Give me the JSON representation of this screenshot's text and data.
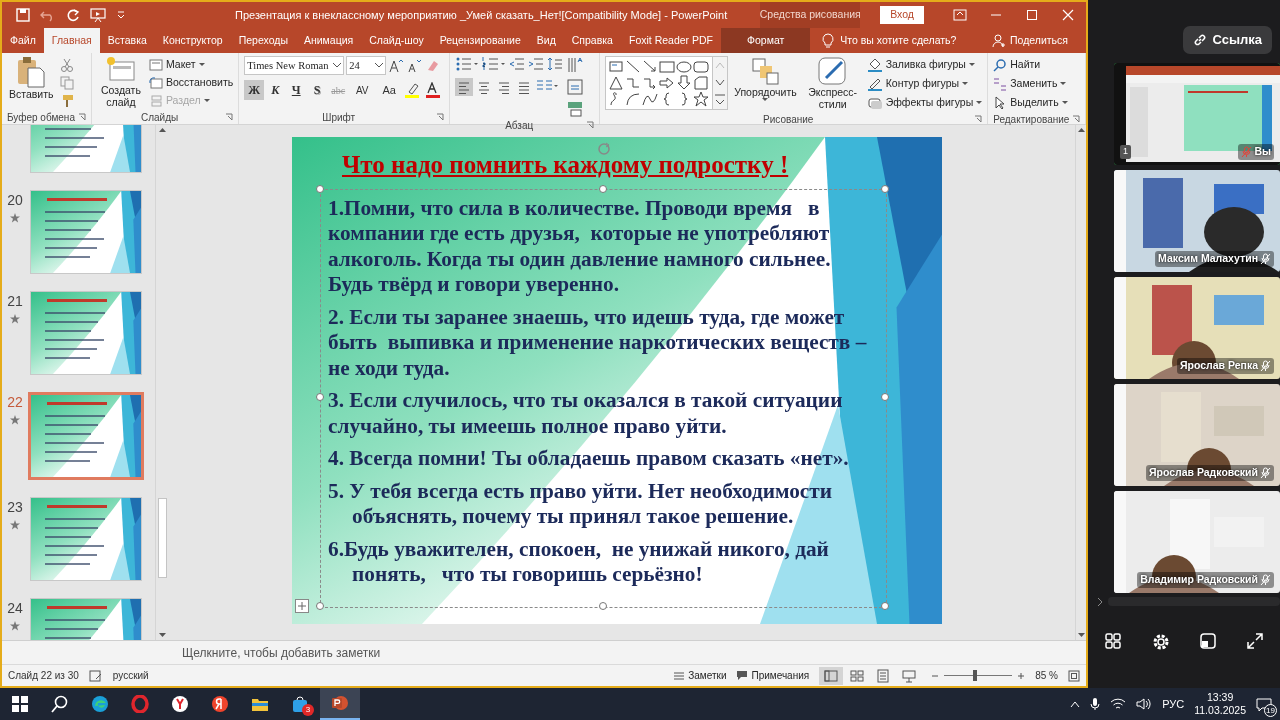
{
  "window": {
    "title": "Презентация к внеклассному мероприятию _Умей сказать_Нет![Compatibility Mode]  -  PowerPoint",
    "context_label": "Средства рисования",
    "sign_in": "Вход"
  },
  "tabs": [
    {
      "label": "Файл",
      "selected": false,
      "kind": "normal"
    },
    {
      "label": "Главная",
      "selected": true,
      "kind": "normal"
    },
    {
      "label": "Вставка",
      "selected": false,
      "kind": "normal"
    },
    {
      "label": "Конструктор",
      "selected": false,
      "kind": "normal"
    },
    {
      "label": "Переходы",
      "selected": false,
      "kind": "normal"
    },
    {
      "label": "Анимация",
      "selected": false,
      "kind": "normal"
    },
    {
      "label": "Слайд-шоу",
      "selected": false,
      "kind": "normal"
    },
    {
      "label": "Рецензирование",
      "selected": false,
      "kind": "normal"
    },
    {
      "label": "Вид",
      "selected": false,
      "kind": "normal"
    },
    {
      "label": "Справка",
      "selected": false,
      "kind": "normal"
    },
    {
      "label": "Foxit Reader PDF",
      "selected": false,
      "kind": "normal"
    },
    {
      "label": "Формат",
      "selected": false,
      "kind": "contextual"
    }
  ],
  "tell_me": "Что вы хотите сделать?",
  "share": "Поделиться",
  "ribbon": {
    "clipboard": {
      "label": "Буфер обмена",
      "paste": "Вставить"
    },
    "slides": {
      "label": "Слайды",
      "new_slide": "Создать слайд",
      "layout": "Макет",
      "reset": "Восстановить",
      "section": "Раздел",
      "section_disabled": true
    },
    "font": {
      "label": "Шрифт",
      "name": "Times New Roman",
      "size": "24",
      "format_buttons": [
        {
          "label": "Ж",
          "selected": true
        },
        {
          "label": "К",
          "selected": false
        },
        {
          "label": "Ч",
          "selected": false
        },
        {
          "label": "S",
          "selected": false
        },
        {
          "label": "abc",
          "selected": false
        },
        {
          "label": "AV",
          "selected": false
        },
        {
          "label": "Aa",
          "selected": false
        }
      ]
    },
    "paragraph": {
      "label": "Абзац",
      "align_buttons": [
        {
          "selected": true
        },
        {
          "selected": false
        },
        {
          "selected": false
        },
        {
          "selected": false
        }
      ]
    },
    "drawing": {
      "label": "Рисование",
      "arrange": "Упорядочить",
      "quick_styles": "Экспресс-стили",
      "fill": "Заливка фигуры",
      "outline": "Контур фигуры",
      "effects": "Эффекты фигуры"
    },
    "editing": {
      "label": "Редактирование",
      "find": "Найти",
      "replace": "Заменить",
      "select": "Выделить"
    }
  },
  "thumbnails": [
    {
      "selected": false
    },
    {
      "number": "20",
      "selected": false
    },
    {
      "number": "21",
      "selected": false
    },
    {
      "number": "22",
      "selected": true
    },
    {
      "number": "23",
      "selected": false
    },
    {
      "number": "24",
      "selected": false
    }
  ],
  "slide": {
    "title": "Что надо помнить каждому подростку !",
    "points": [
      {
        "text": "1.Помни, что сила в количестве. Проводи время   в компании где есть друзья,  которые не употребляют алкоголь. Когда ты один давление намного сильнее. Будь твёрд и говори уверенно."
      },
      {
        "text": "2. Если ты заранее знаешь, что идешь туда, где может быть  выпивка и применение наркотических веществ – не ходи туда."
      },
      {
        "text": "3. Если случилось, что ты оказался в такой ситуации случайно, ты имеешь полное право уйти."
      },
      {
        "text": "4. Всегда помни! Ты обладаешь правом сказать «нет»."
      },
      {
        "text": "5. У тебя всегда есть право уйти. Нет необходимости объяснять, почему ты принял такое решение.",
        "hanging": true
      },
      {
        "text": "6.Будь уважителен, спокоен,  не унижай никого, дай понять,   что ты говоришь серьёзно!",
        "hanging": true
      }
    ]
  },
  "notes_placeholder": "Щелкните, чтобы добавить заметки",
  "status_bar": {
    "slide": "Слайд 22 из 30",
    "language": "русский",
    "notes": "Заметки",
    "comments": "Примечания",
    "views": [
      {
        "selected": true
      },
      {
        "selected": false
      },
      {
        "selected": false
      },
      {
        "selected": false
      }
    ],
    "zoom_slider": {
      "level": 0.45
    },
    "zoom": "85 %"
  },
  "meeting": {
    "link": "Ссылка",
    "tiles": [
      {
        "name": "Вы",
        "kind": "screen",
        "badge": "1",
        "selected": true,
        "muted": true
      },
      {
        "name": "Максим Малахутин",
        "kind": "camera",
        "selected": false,
        "muted": true
      },
      {
        "name": "Ярослав Репка",
        "kind": "camera",
        "selected": false,
        "muted": true
      },
      {
        "name": "Ярослав Радковский",
        "kind": "camera",
        "selected": false,
        "muted": true
      },
      {
        "name": "Владимир Радковский",
        "kind": "camera",
        "selected": false,
        "muted": true
      }
    ]
  },
  "taskbar": {
    "apps": [
      {
        "kind": "start",
        "selected": false
      },
      {
        "kind": "search",
        "selected": false
      },
      {
        "kind": "edge",
        "selected": false
      },
      {
        "kind": "opera",
        "selected": false
      },
      {
        "kind": "ybrowser",
        "selected": false
      },
      {
        "kind": "yandex",
        "selected": false
      },
      {
        "kind": "explorer",
        "selected": false
      },
      {
        "kind": "store",
        "selected": false,
        "badge": "3"
      },
      {
        "kind": "powerpoint",
        "selected": true
      }
    ],
    "language": "РУС",
    "time": "13:39",
    "date": "11.03.2025",
    "notifications": "19"
  }
}
